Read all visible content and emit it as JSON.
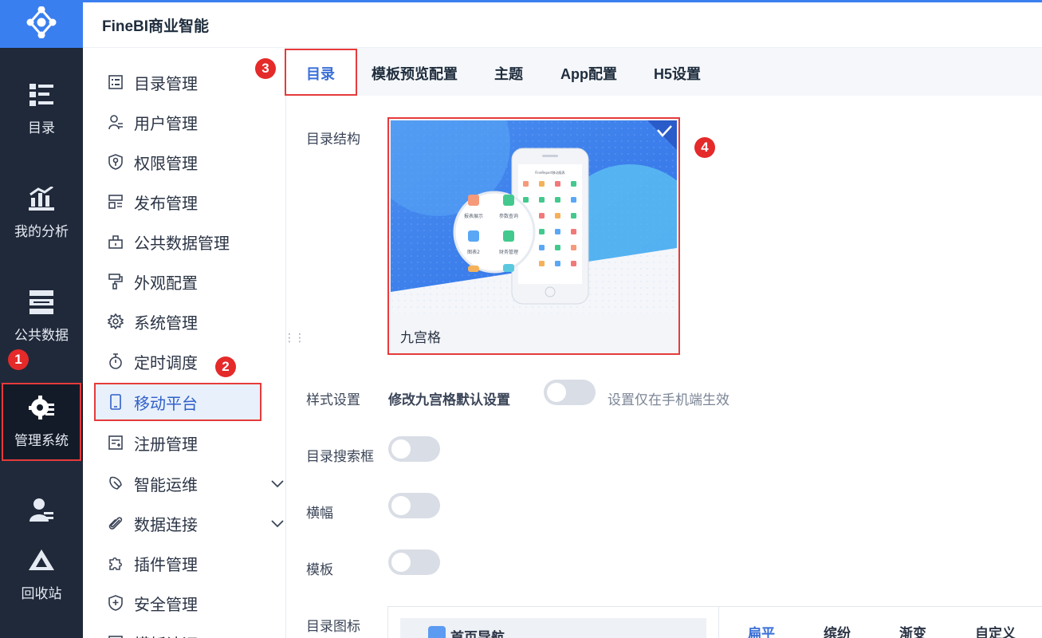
{
  "header": {
    "title": "FineBI商业智能"
  },
  "rail": {
    "items": [
      {
        "label": "目录",
        "icon": "catalog-icon"
      },
      {
        "label": "我的分析",
        "icon": "analysis-icon"
      },
      {
        "label": "公共数据",
        "icon": "public-data-icon"
      },
      {
        "label": "管理系统",
        "icon": "manage-system-icon"
      },
      {
        "label": "",
        "icon": "user-icon"
      },
      {
        "label": "回收站",
        "icon": "recycle-icon"
      }
    ]
  },
  "sidebar": {
    "items": [
      {
        "label": "目录管理"
      },
      {
        "label": "用户管理"
      },
      {
        "label": "权限管理"
      },
      {
        "label": "发布管理"
      },
      {
        "label": "公共数据管理"
      },
      {
        "label": "外观配置"
      },
      {
        "label": "系统管理"
      },
      {
        "label": "定时调度"
      },
      {
        "label": "移动平台"
      },
      {
        "label": "注册管理"
      },
      {
        "label": "智能运维"
      },
      {
        "label": "数据连接"
      },
      {
        "label": "插件管理"
      },
      {
        "label": "安全管理"
      },
      {
        "label": "模板认证"
      }
    ]
  },
  "tabs": [
    {
      "label": "目录"
    },
    {
      "label": "模板预览配置"
    },
    {
      "label": "主题"
    },
    {
      "label": "App配置"
    },
    {
      "label": "H5设置"
    }
  ],
  "badges": {
    "b1": "1",
    "b2": "2",
    "b3": "3",
    "b4": "4"
  },
  "content": {
    "catalog_structure_label": "目录结构",
    "card_caption": "九宫格",
    "style_settings_label": "样式设置",
    "modify_default_label": "修改九宫格默认设置",
    "mobile_only_hint": "设置仅在手机端生效",
    "catalog_search_label": "目录搜索框",
    "banner_label": "横幅",
    "template_label": "模板",
    "catalog_icon_label": "目录图标",
    "home_nav_label": "首页导航",
    "icon_styles": [
      "扁平",
      "缤纷",
      "渐变",
      "自定义"
    ]
  },
  "phone_mock": {
    "app_title": "FineReport移动报表",
    "bubble_labels": [
      "报表展示",
      "参数查询",
      "图表2",
      "财务管理"
    ]
  },
  "colors": {
    "accent": "#3a7ff0",
    "rail_bg": "#20293a",
    "highlight": "#e63b3b"
  }
}
